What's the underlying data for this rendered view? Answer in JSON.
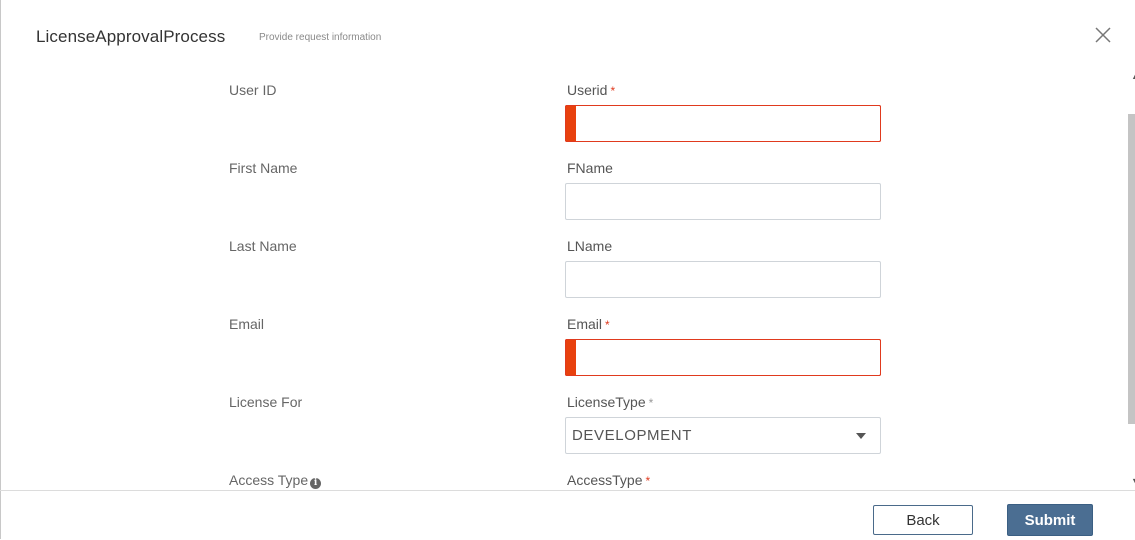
{
  "header": {
    "title": "LicenseApprovalProcess",
    "subtitle": "Provide request information"
  },
  "form": {
    "rows": [
      {
        "label": "User ID",
        "field_label": "Userid",
        "required": true,
        "value": "",
        "invalid": true
      },
      {
        "label": "First Name",
        "field_label": "FName",
        "required": false,
        "value": ""
      },
      {
        "label": "Last Name",
        "field_label": "LName",
        "required": false,
        "value": ""
      },
      {
        "label": "Email",
        "field_label": "Email",
        "required": true,
        "value": "",
        "invalid": true
      },
      {
        "label": "License For",
        "field_label": "LicenseType",
        "required": true,
        "value": "DEVELOPMENT"
      },
      {
        "label": "Access Type",
        "field_label": "AccessType",
        "required": true
      }
    ],
    "required_marker": "*"
  },
  "footer": {
    "back_label": "Back",
    "submit_label": "Submit"
  },
  "colors": {
    "error": "#e03a1e",
    "primary": "#4b6e92"
  },
  "icons": {
    "close": "close-icon",
    "info": "info-icon",
    "dropdown": "chevron-down-icon"
  }
}
